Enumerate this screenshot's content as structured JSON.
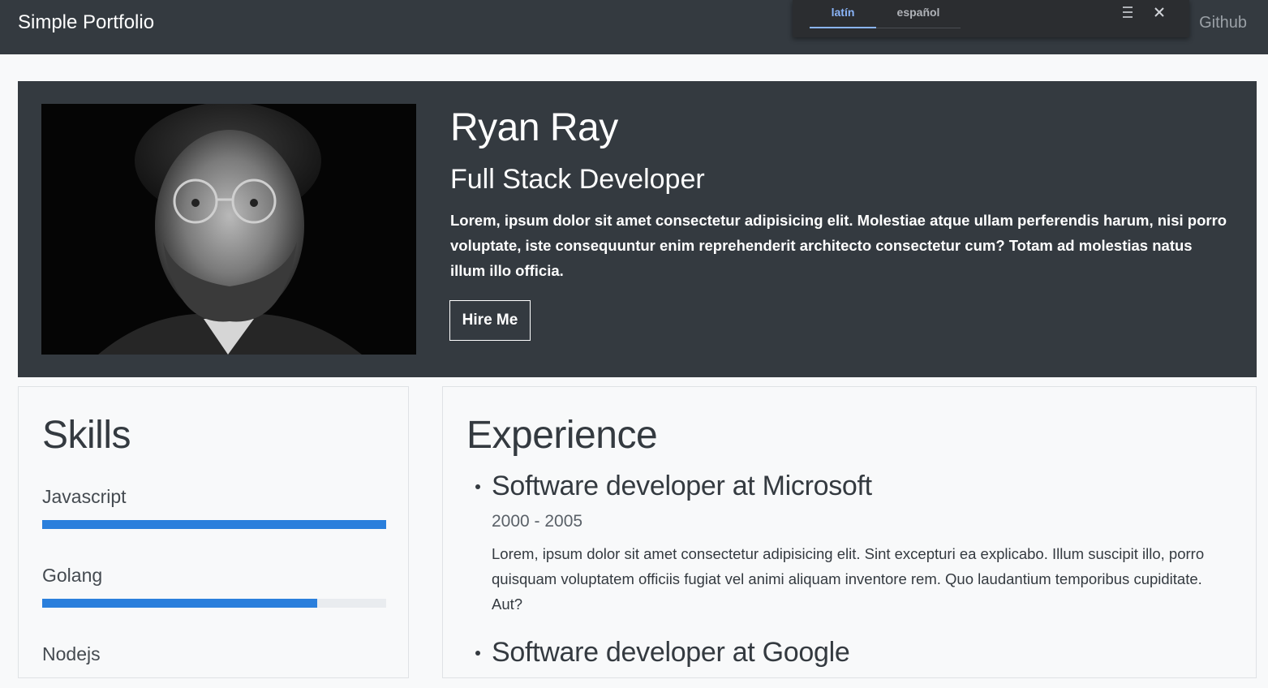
{
  "navbar": {
    "brand": "Simple Portfolio",
    "link": "Github"
  },
  "translate": {
    "tabs": [
      "latín",
      "español"
    ],
    "active_tab": "latín"
  },
  "hero": {
    "name": "Ryan Ray",
    "role": "Full Stack Developer",
    "bio": "Lorem, ipsum dolor sit amet consectetur adipisicing elit. Molestiae atque ullam perferendis harum, nisi porro voluptate, iste consequuntur enim reprehenderit architecto consectetur cum? Totam ad molestias natus illum illo officia.",
    "hire_label": "Hire Me"
  },
  "skills": {
    "title": "Skills",
    "items": [
      {
        "label": "Javascript",
        "level": 1.0
      },
      {
        "label": "Golang",
        "level": 0.8
      },
      {
        "label": "Nodejs",
        "level": null
      }
    ],
    "bar_color": "#2a7fdc"
  },
  "experience": {
    "title": "Experience",
    "items": [
      {
        "title": "Software developer at Microsoft",
        "dates": "2000 - 2005",
        "desc": "Lorem, ipsum dolor sit amet consectetur adipisicing elit. Sint excepturi ea explicabo. Illum suscipit illo, porro quisquam voluptatem officiis fugiat vel animi aliquam inventore rem. Quo laudantium temporibus cupiditate. Aut?"
      },
      {
        "title": "Software developer at Google"
      }
    ]
  },
  "colors": {
    "navbar_bg": "#343a40",
    "page_bg": "#f8f9fa",
    "accent": "#8ab4f8"
  }
}
